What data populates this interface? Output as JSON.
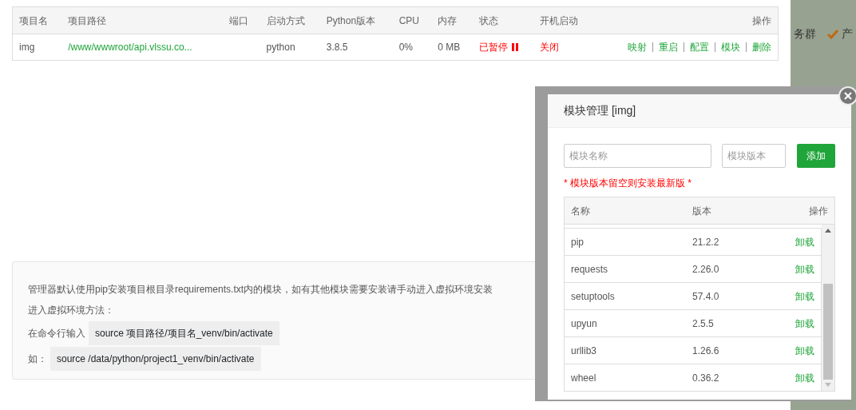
{
  "project_table": {
    "columns": [
      "项目名",
      "项目路径",
      "端口",
      "启动方式",
      "Python版本",
      "CPU",
      "内存",
      "状态",
      "开机启动",
      "操作"
    ],
    "rows": [
      {
        "name": "img",
        "path": "/www/wwwroot/api.vlssu.co...",
        "startup": "python",
        "python_version": "3.8.5",
        "cpu": "0%",
        "memory": "0 MB",
        "status": {
          "text": "已暂停",
          "running": false
        },
        "autostart": {
          "text": "关闭",
          "on": false
        },
        "actions": [
          "映射",
          "重启",
          "配置",
          "模块",
          "删除"
        ]
      }
    ]
  },
  "background_strip": [
    {
      "kind": "text",
      "text": "务群"
    },
    {
      "kind": "check",
      "text": "产"
    }
  ],
  "info_box": [
    {
      "kind": "text",
      "text": "管理器默认使用pip安装项目根目录requirements.txt内的模块，如有其他模块需要安装请手动进入虚拟环境安装"
    },
    {
      "kind": "text",
      "text": "进入虚拟环境方法："
    },
    {
      "kind": "code",
      "label": "在命令行输入",
      "code": "source 项目路径/项目名_venv/bin/activate"
    },
    {
      "kind": "code",
      "label": "如：",
      "code": "source /data/python/project1_venv/bin/activate"
    }
  ],
  "modal": {
    "title": "模块管理 [img]",
    "name_field": {
      "placeholder": "模块名称"
    },
    "version_field": {
      "placeholder": "模块版本"
    },
    "add_button": "添加",
    "note": "* 模块版本留空则安装最新版 *",
    "columns": [
      "名称",
      "版本",
      "操作"
    ],
    "rows": [
      {
        "name": "pip",
        "version": "21.2.2",
        "action": "卸载"
      },
      {
        "name": "requests",
        "version": "2.26.0",
        "action": "卸载"
      },
      {
        "name": "setuptools",
        "version": "57.4.0",
        "action": "卸载"
      },
      {
        "name": "upyun",
        "version": "2.5.5",
        "action": "卸载"
      },
      {
        "name": "urllib3",
        "version": "1.26.6",
        "action": "卸载"
      },
      {
        "name": "wheel",
        "version": "0.36.2",
        "action": "卸载"
      }
    ]
  }
}
